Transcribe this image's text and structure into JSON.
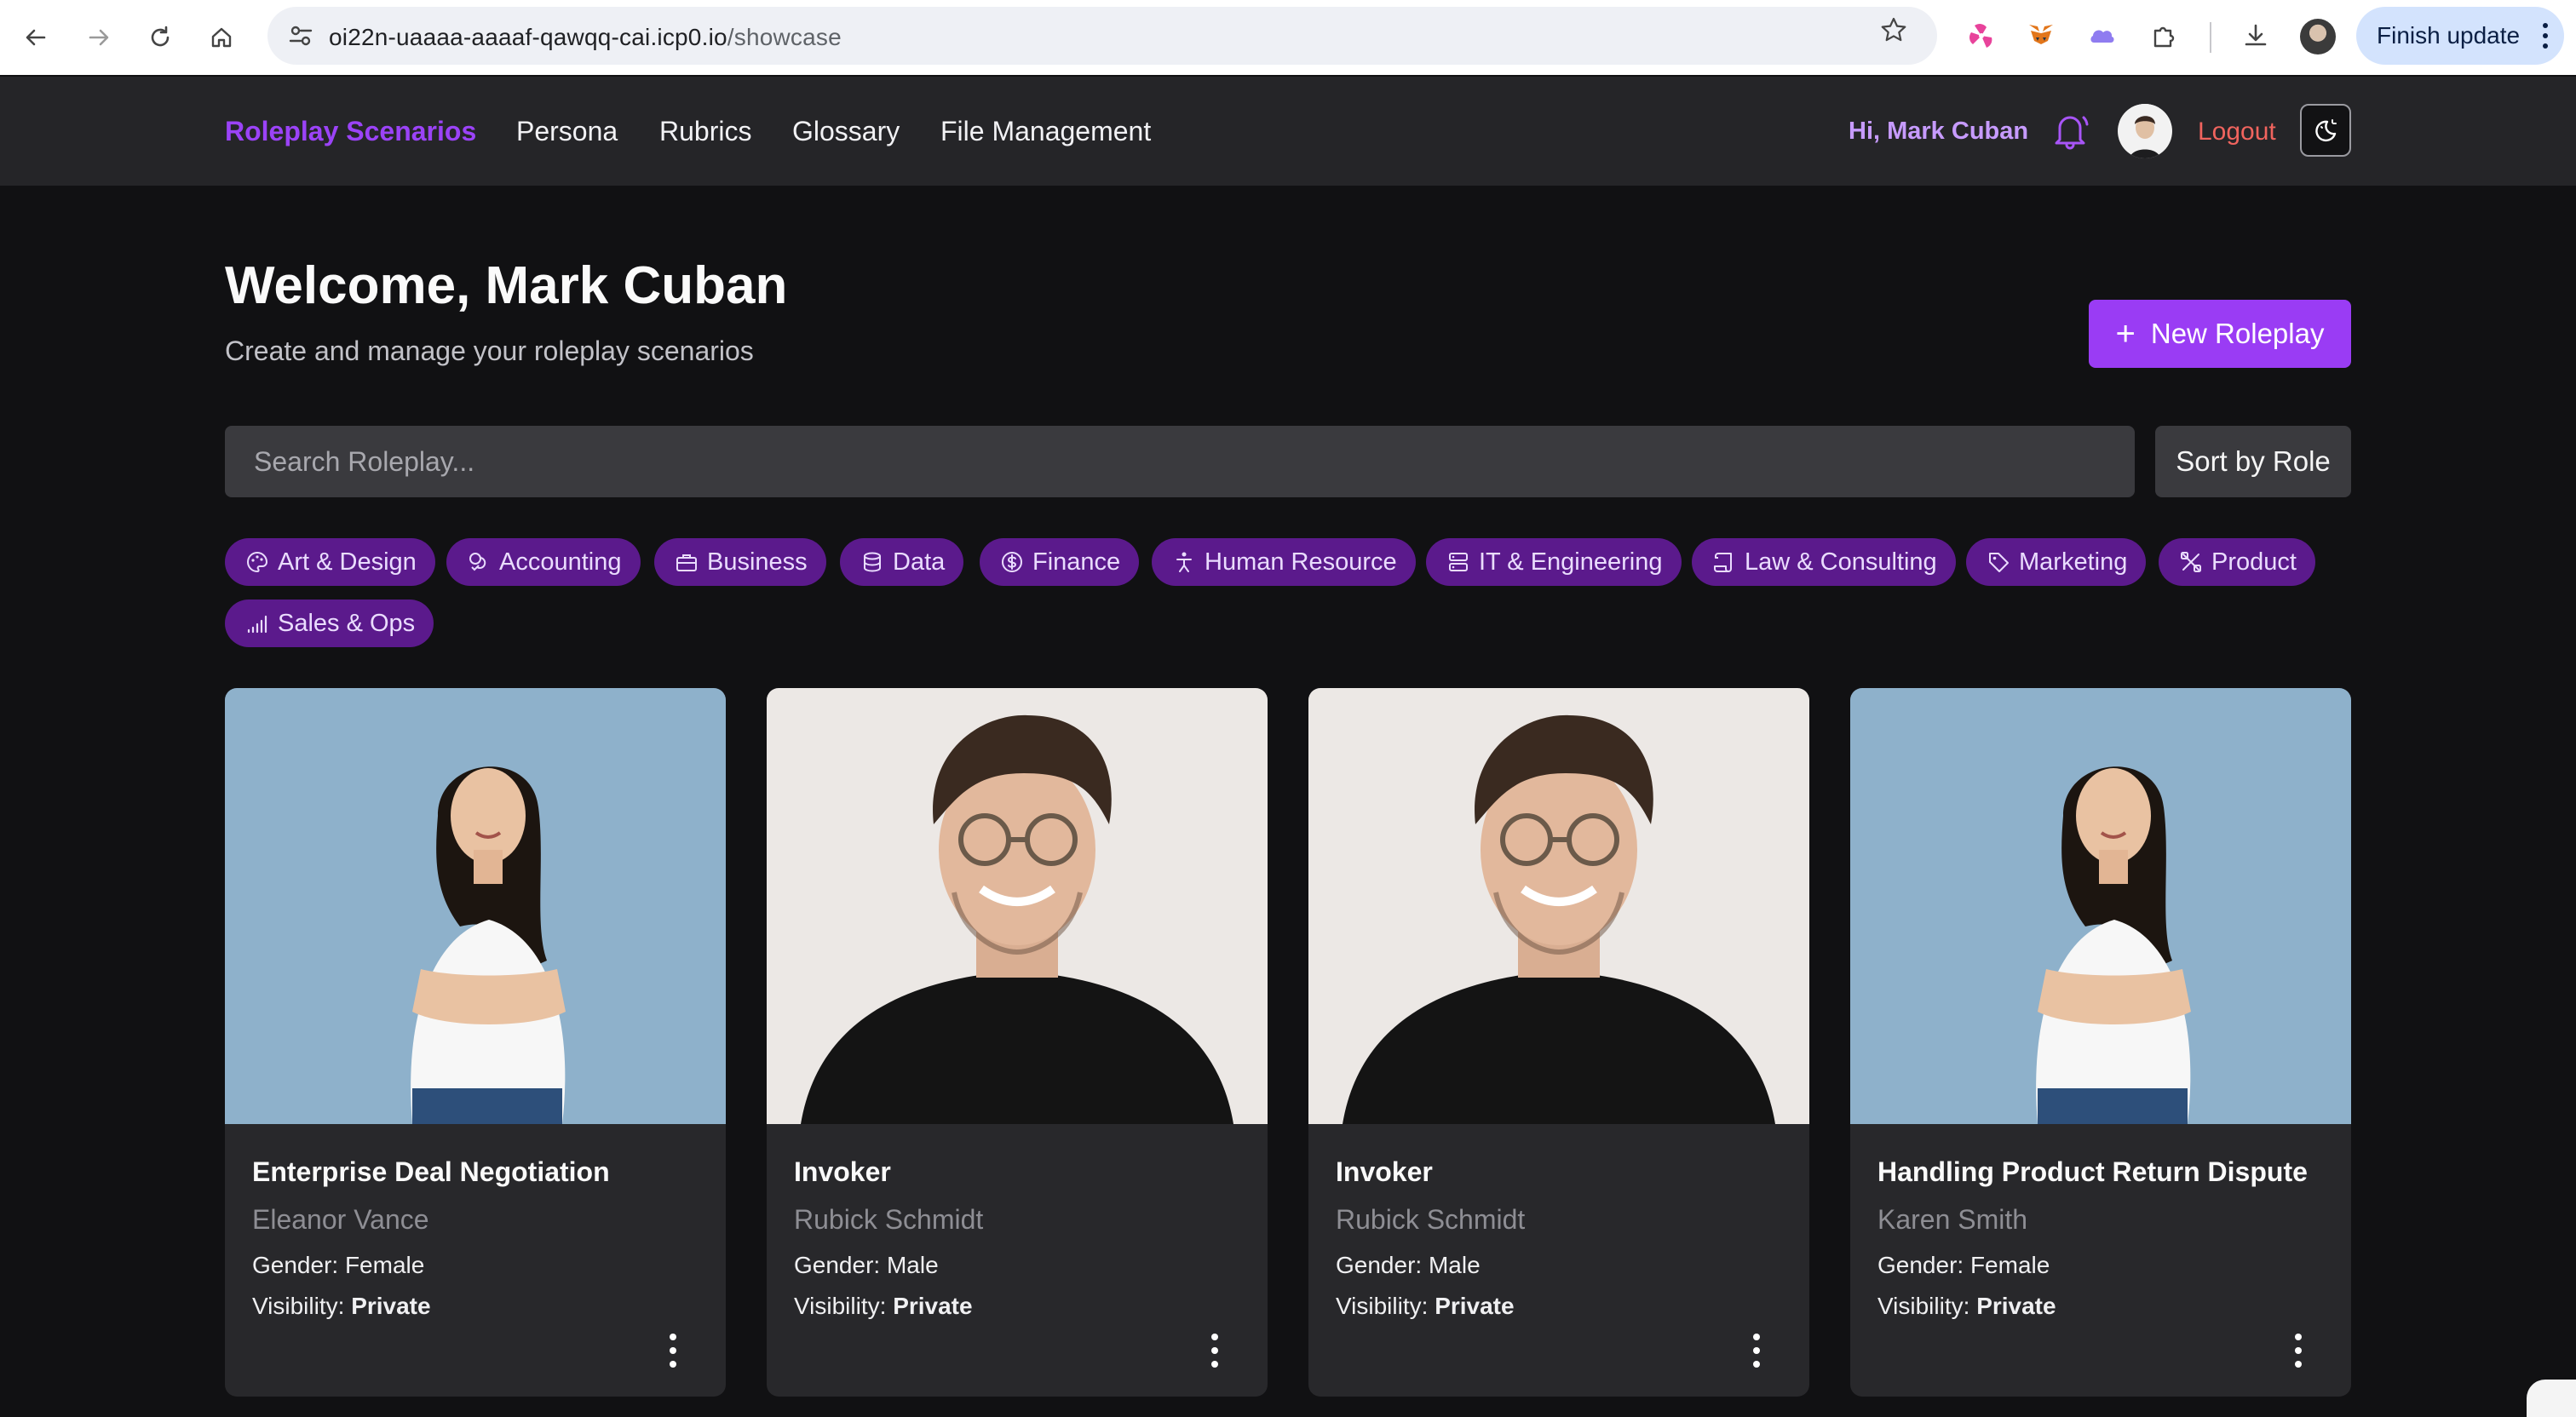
{
  "browser": {
    "url_host": "oi22n-uaaaa-aaaaf-qawqq-cai.icp0.io",
    "url_path": "/showcase",
    "finish_update_label": "Finish update"
  },
  "nav": {
    "links": [
      "Roleplay Scenarios",
      "Persona",
      "Rubrics",
      "Glossary",
      "File Management"
    ],
    "greeting": "Hi, Mark Cuban",
    "logout_label": "Logout"
  },
  "header": {
    "title": "Welcome, Mark Cuban",
    "subtitle": "Create and manage your roleplay scenarios",
    "new_button_label": "New Roleplay"
  },
  "search": {
    "placeholder": "Search Roleplay...",
    "value": "",
    "sort_label": "Sort by Role"
  },
  "categories": [
    {
      "label": "Art & Design",
      "icon": "palette-icon"
    },
    {
      "label": "Accounting",
      "icon": "coins-icon"
    },
    {
      "label": "Business",
      "icon": "briefcase-icon"
    },
    {
      "label": "Data",
      "icon": "database-icon"
    },
    {
      "label": "Finance",
      "icon": "dollar-circle-icon"
    },
    {
      "label": "Human Resource",
      "icon": "person-icon"
    },
    {
      "label": "IT & Engineering",
      "icon": "server-icon"
    },
    {
      "label": "Law & Consulting",
      "icon": "scroll-icon"
    },
    {
      "label": "Marketing",
      "icon": "tag-icon"
    },
    {
      "label": "Product",
      "icon": "tools-icon"
    },
    {
      "label": "Sales & Ops",
      "icon": "signal-bars-icon"
    }
  ],
  "cards": [
    {
      "title": "Enterprise Deal Negotiation",
      "persona": "Eleanor Vance",
      "gender_label": "Gender:",
      "gender": "Female",
      "visibility_label": "Visibility:",
      "visibility": "Private",
      "image": "woman-portrait"
    },
    {
      "title": "Invoker",
      "persona": "Rubick Schmidt",
      "gender_label": "Gender:",
      "gender": "Male",
      "visibility_label": "Visibility:",
      "visibility": "Private",
      "image": "man-portrait"
    },
    {
      "title": "Invoker",
      "persona": "Rubick Schmidt",
      "gender_label": "Gender:",
      "gender": "Male",
      "visibility_label": "Visibility:",
      "visibility": "Private",
      "image": "man-portrait"
    },
    {
      "title": "Handling Product Return Dispute",
      "persona": "Karen Smith",
      "gender_label": "Gender:",
      "gender": "Female",
      "visibility_label": "Visibility:",
      "visibility": "Private",
      "image": "woman-portrait"
    }
  ],
  "colors": {
    "accent": "#9a3cf4",
    "chip_bg": "#5b1a8c",
    "logout": "#f0645e",
    "page_bg": "#111113",
    "card_bg": "#28282b"
  }
}
